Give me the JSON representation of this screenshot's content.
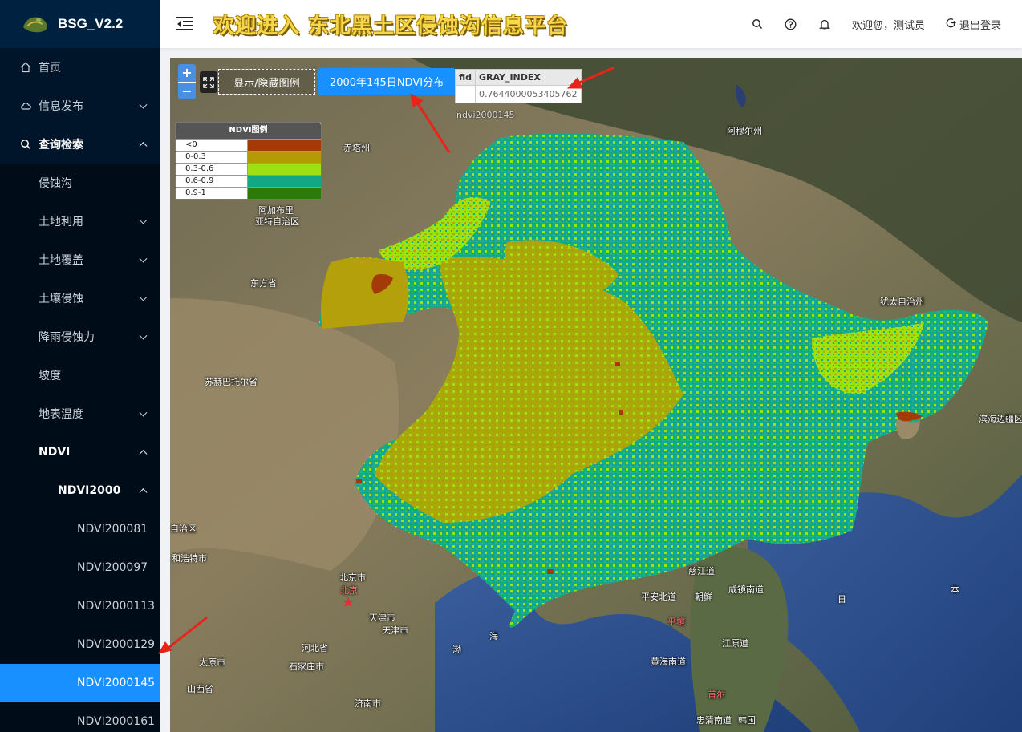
{
  "app": {
    "logo_text": "BSG_V2.2",
    "title": "欢迎进入 东北黑土区侵蚀沟信息平台"
  },
  "header": {
    "welcome": "欢迎您，测试员",
    "logout": "退出登录",
    "icons": [
      "search-icon",
      "help-icon",
      "bell-icon"
    ]
  },
  "sidebar": {
    "items": [
      {
        "label": "首页",
        "icon": "home-icon"
      },
      {
        "label": "信息发布",
        "icon": "cloud-icon"
      },
      {
        "label": "查询检索",
        "icon": "search-icon"
      },
      {
        "label": "侵蚀沟"
      },
      {
        "label": "土地利用"
      },
      {
        "label": "土地覆盖"
      },
      {
        "label": "土壤侵蚀"
      },
      {
        "label": "降雨侵蚀力"
      },
      {
        "label": "坡度"
      },
      {
        "label": "地表温度"
      },
      {
        "label": "NDVI"
      },
      {
        "label": "NDVI2000"
      },
      {
        "label": "NDVI200081"
      },
      {
        "label": "NDVI200097"
      },
      {
        "label": "NDVI2000113"
      },
      {
        "label": "NDVI2000129"
      },
      {
        "label": "NDVI2000145"
      },
      {
        "label": "NDVI2000161"
      }
    ],
    "active": "NDVI2000145"
  },
  "map": {
    "zoom_in": "+",
    "zoom_out": "−",
    "toggle_legend": "显示/隐藏图例",
    "layer_button": "2000年145日NDVI分布",
    "attr_table": {
      "headers": [
        "fid",
        "GRAY_INDEX"
      ],
      "row": [
        "",
        "0.7644000053405762"
      ]
    },
    "layer_name": "ndvi2000145",
    "legend": {
      "title": "NDVI图例",
      "rows": [
        {
          "label": "<0",
          "color": "#a33a07"
        },
        {
          "label": "0-0.3",
          "color": "#b49a06"
        },
        {
          "label": "0.3-0.6",
          "color": "#9ee010"
        },
        {
          "label": "0.6-0.9",
          "color": "#12a883"
        },
        {
          "label": "0.9-1",
          "color": "#2b7a0a"
        }
      ]
    },
    "place_labels": [
      "阿穆尔州",
      "赤塔州",
      "阿加布里",
      "亚特自治区",
      "东方省",
      "犹太自治州",
      "苏赫巴托尔省",
      "滨海边疆区",
      "自治区",
      "和浩特市",
      "北京市",
      "北京",
      "天津市",
      "天津市",
      "河北省",
      "太原市",
      "石家庄市",
      "山西省",
      "济南市",
      "慈江道",
      "朝鲜",
      "平安北道",
      "咸镜南道",
      "平壤",
      "江原道",
      "黄海南道",
      "首尔",
      "忠清南道",
      "韩国",
      "日",
      "本",
      "渤",
      "海"
    ]
  }
}
